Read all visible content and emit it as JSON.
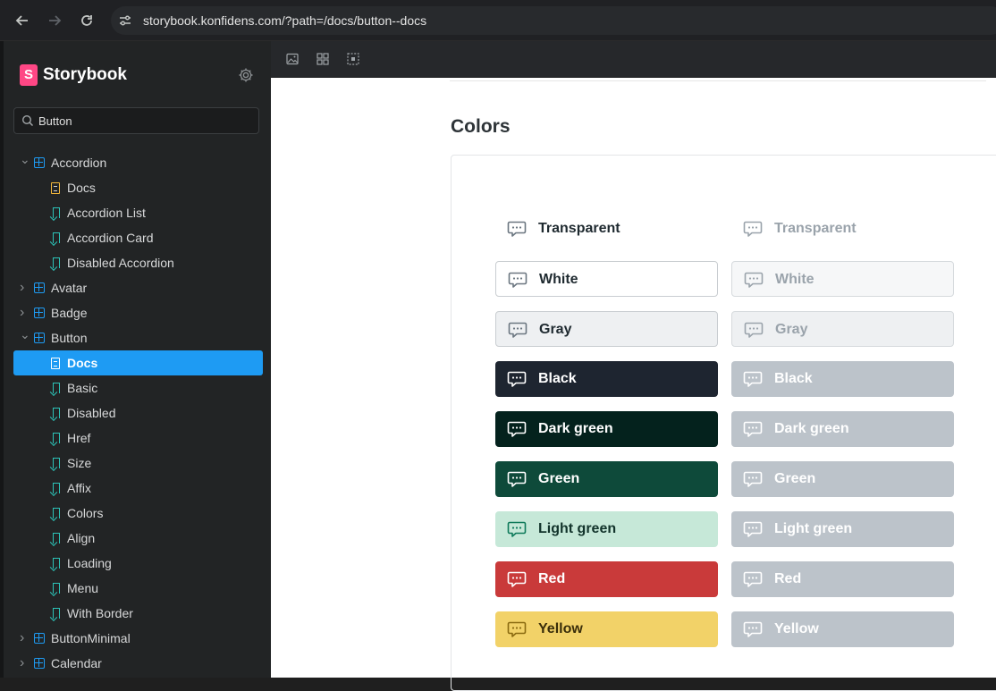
{
  "browser": {
    "url": "storybook.konfidens.com/?path=/docs/button--docs"
  },
  "sidebar": {
    "brand": "Storybook",
    "search_value": "Button",
    "tree": [
      {
        "label": "Accordion",
        "kind": "component",
        "expanded": true
      },
      {
        "label": "Docs",
        "kind": "docs"
      },
      {
        "label": "Accordion List",
        "kind": "story"
      },
      {
        "label": "Accordion Card",
        "kind": "story"
      },
      {
        "label": "Disabled Accordion",
        "kind": "story"
      },
      {
        "label": "Avatar",
        "kind": "component",
        "expanded": false
      },
      {
        "label": "Badge",
        "kind": "component",
        "expanded": false
      },
      {
        "label": "Button",
        "kind": "component",
        "expanded": true
      },
      {
        "label": "Docs",
        "kind": "docs",
        "selected": true
      },
      {
        "label": "Basic",
        "kind": "story"
      },
      {
        "label": "Disabled",
        "kind": "story"
      },
      {
        "label": "Href",
        "kind": "story"
      },
      {
        "label": "Size",
        "kind": "story"
      },
      {
        "label": "Affix",
        "kind": "story"
      },
      {
        "label": "Colors",
        "kind": "story"
      },
      {
        "label": "Align",
        "kind": "story"
      },
      {
        "label": "Loading",
        "kind": "story"
      },
      {
        "label": "Menu",
        "kind": "story"
      },
      {
        "label": "With Border",
        "kind": "story"
      },
      {
        "label": "ButtonMinimal",
        "kind": "component",
        "expanded": false
      },
      {
        "label": "Calendar",
        "kind": "component",
        "expanded": false
      }
    ]
  },
  "toolbar": {
    "icons": [
      "image-icon",
      "grid-icon",
      "outline-icon"
    ]
  },
  "main": {
    "section_title": "Colors",
    "rows": [
      {
        "label": "Transparent",
        "bg": "transparent",
        "fg": "#1f2a30",
        "border": "none",
        "icon": "#6b7680",
        "disabled_label": "Transparent"
      },
      {
        "label": "White",
        "bg": "#ffffff",
        "fg": "#1f2a30",
        "border": "#c9cdd1",
        "icon": "#6b7680",
        "disabled_label": "White"
      },
      {
        "label": "Gray",
        "bg": "#eef0f2",
        "fg": "#1f2a30",
        "border": "#c9cdd1",
        "icon": "#6b7680",
        "disabled_label": "Gray"
      },
      {
        "label": "Black",
        "bg": "#1e2530",
        "fg": "#ffffff",
        "border": "none",
        "icon": "#ffffff",
        "disabled_label": "Black"
      },
      {
        "label": "Dark green",
        "bg": "#04221d",
        "fg": "#ffffff",
        "border": "none",
        "icon": "#ffffff",
        "disabled_label": "Dark green"
      },
      {
        "label": "Green",
        "bg": "#0e4a3a",
        "fg": "#ffffff",
        "border": "none",
        "icon": "#ffffff",
        "disabled_label": "Green"
      },
      {
        "label": "Light green",
        "bg": "#c6e8d8",
        "fg": "#12332b",
        "border": "none",
        "icon": "#0e7a5a",
        "disabled_label": "Light green"
      },
      {
        "label": "Red",
        "bg": "#c93a3a",
        "fg": "#ffffff",
        "border": "none",
        "icon": "#ffffff",
        "disabled_label": "Red"
      },
      {
        "label": "Yellow",
        "bg": "#f2d268",
        "fg": "#3a2e0a",
        "border": "none",
        "icon": "#8a6a10",
        "disabled_label": "Yellow"
      }
    ],
    "disabled_colors": {
      "text_light": "#9aa3ab",
      "fill": "#bcc3ca",
      "fill_text": "#ffffff"
    }
  }
}
